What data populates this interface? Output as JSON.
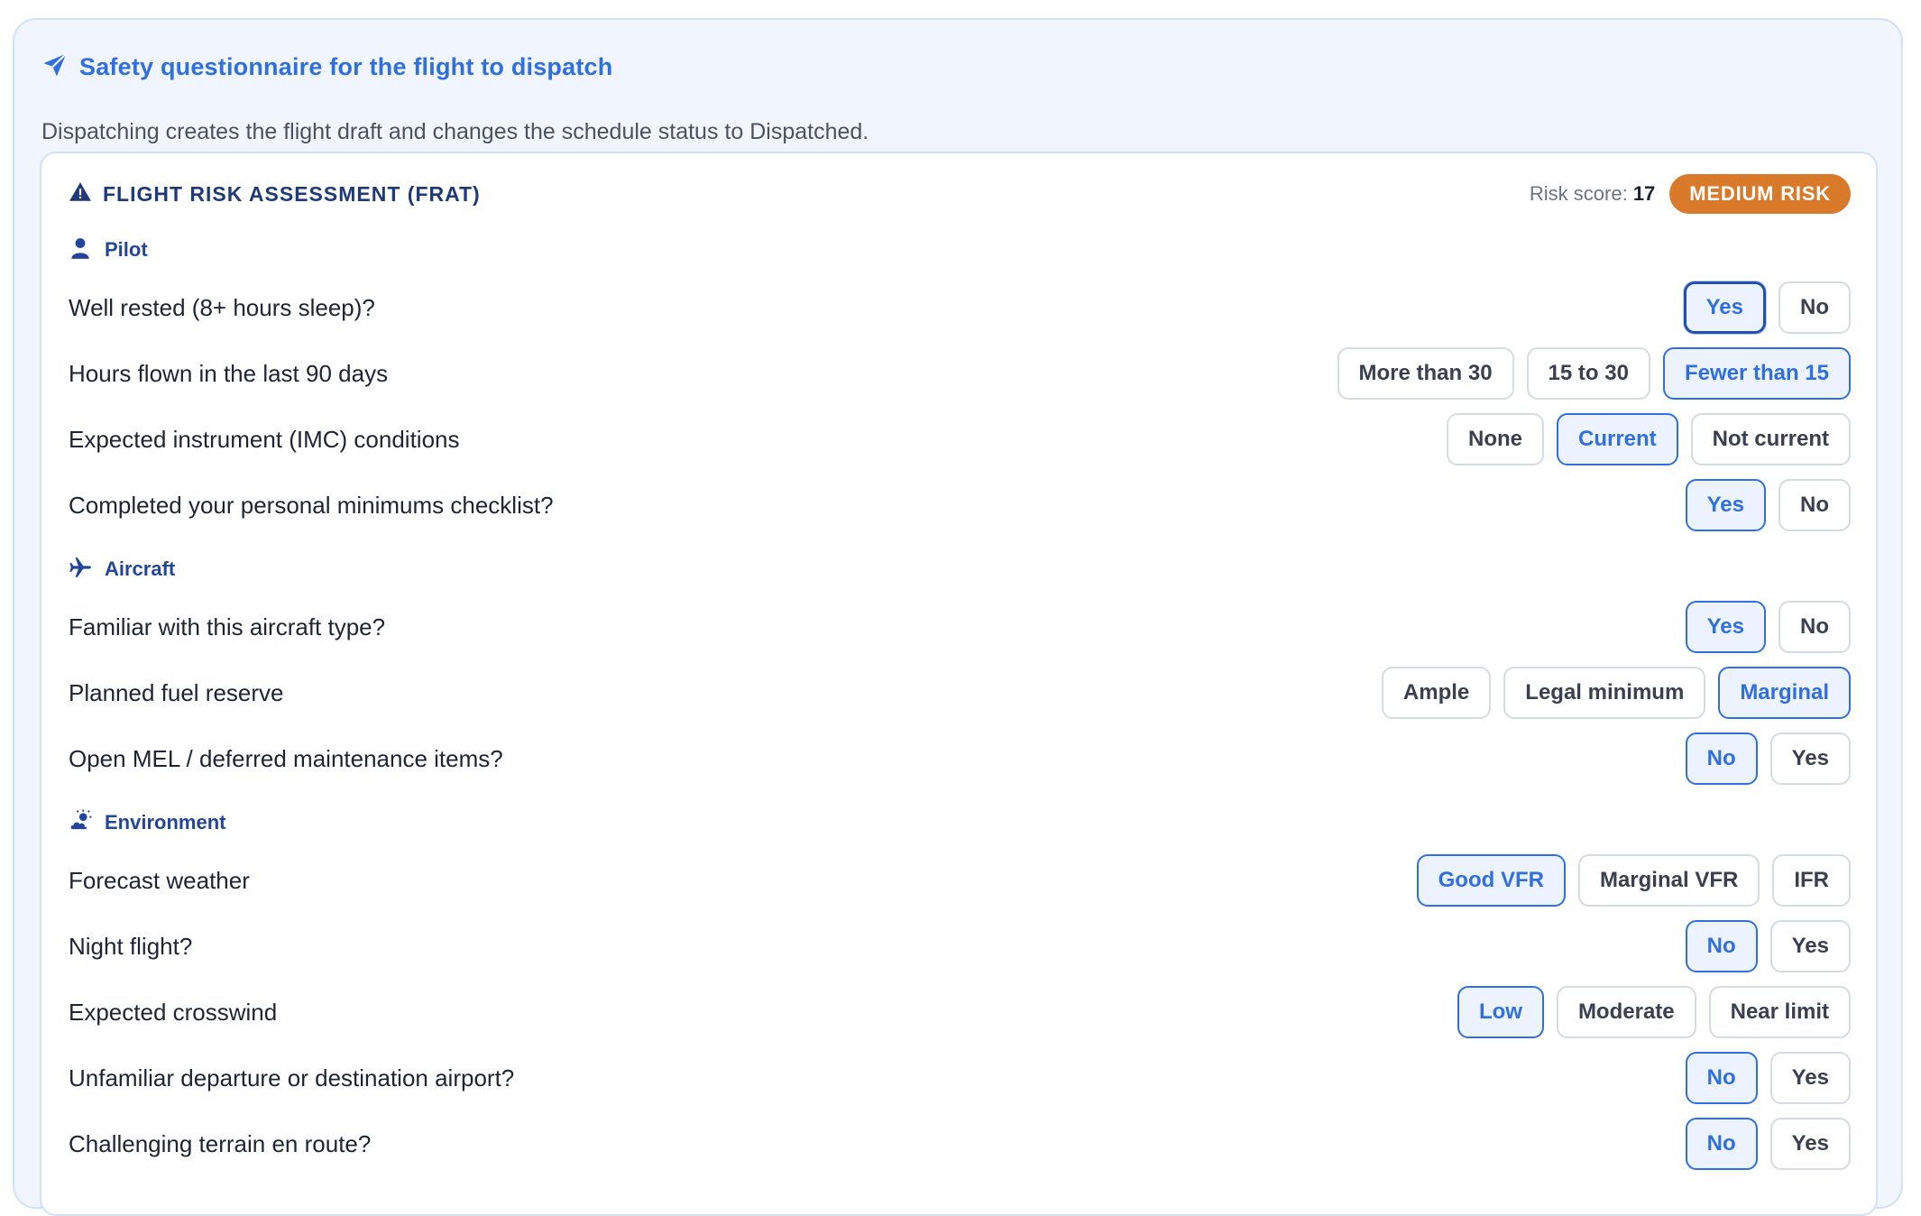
{
  "header": {
    "title": "Safety questionnaire for the flight to dispatch",
    "subtitle": "Dispatching creates the flight draft and changes the schedule status to Dispatched."
  },
  "frat": {
    "title": "FLIGHT RISK ASSESSMENT (FRAT)",
    "risk_label": "Risk score:",
    "risk_value": "17",
    "risk_badge": "MEDIUM RISK"
  },
  "colors": {
    "accent": "#2f6fdf",
    "section_text": "#24469a",
    "badge_medium": "#d97a2b",
    "panel_bg": "#f1f6fe"
  },
  "sections": {
    "pilot": {
      "label": "Pilot",
      "icon": "person-icon",
      "questions": [
        {
          "text": "Well rested (8+ hours sleep)?",
          "options": [
            "Yes",
            "No"
          ],
          "selected": 0,
          "focused": 0
        },
        {
          "text": "Hours flown in the last 90 days",
          "options": [
            "More than 30",
            "15 to 30",
            "Fewer than 15"
          ],
          "selected": 2
        },
        {
          "text": "Expected instrument (IMC) conditions",
          "options": [
            "None",
            "Current",
            "Not current"
          ],
          "selected": 1
        },
        {
          "text": "Completed your personal minimums checklist?",
          "options": [
            "Yes",
            "No"
          ],
          "selected": 0
        }
      ]
    },
    "aircraft": {
      "label": "Aircraft",
      "icon": "plane-icon",
      "questions": [
        {
          "text": "Familiar with this aircraft type?",
          "options": [
            "Yes",
            "No"
          ],
          "selected": 0
        },
        {
          "text": "Planned fuel reserve",
          "options": [
            "Ample",
            "Legal minimum",
            "Marginal"
          ],
          "selected": 2
        },
        {
          "text": "Open MEL / deferred maintenance items?",
          "options": [
            "No",
            "Yes"
          ],
          "selected": 0
        }
      ]
    },
    "environment": {
      "label": "Environment",
      "icon": "cloud-sun-icon",
      "questions": [
        {
          "text": "Forecast weather",
          "options": [
            "Good VFR",
            "Marginal VFR",
            "IFR"
          ],
          "selected": 0
        },
        {
          "text": "Night flight?",
          "options": [
            "No",
            "Yes"
          ],
          "selected": 0
        },
        {
          "text": "Expected crosswind",
          "options": [
            "Low",
            "Moderate",
            "Near limit"
          ],
          "selected": 0
        },
        {
          "text": "Unfamiliar departure or destination airport?",
          "options": [
            "No",
            "Yes"
          ],
          "selected": 0
        },
        {
          "text": "Challenging terrain en route?",
          "options": [
            "No",
            "Yes"
          ],
          "selected": 0
        }
      ]
    }
  }
}
